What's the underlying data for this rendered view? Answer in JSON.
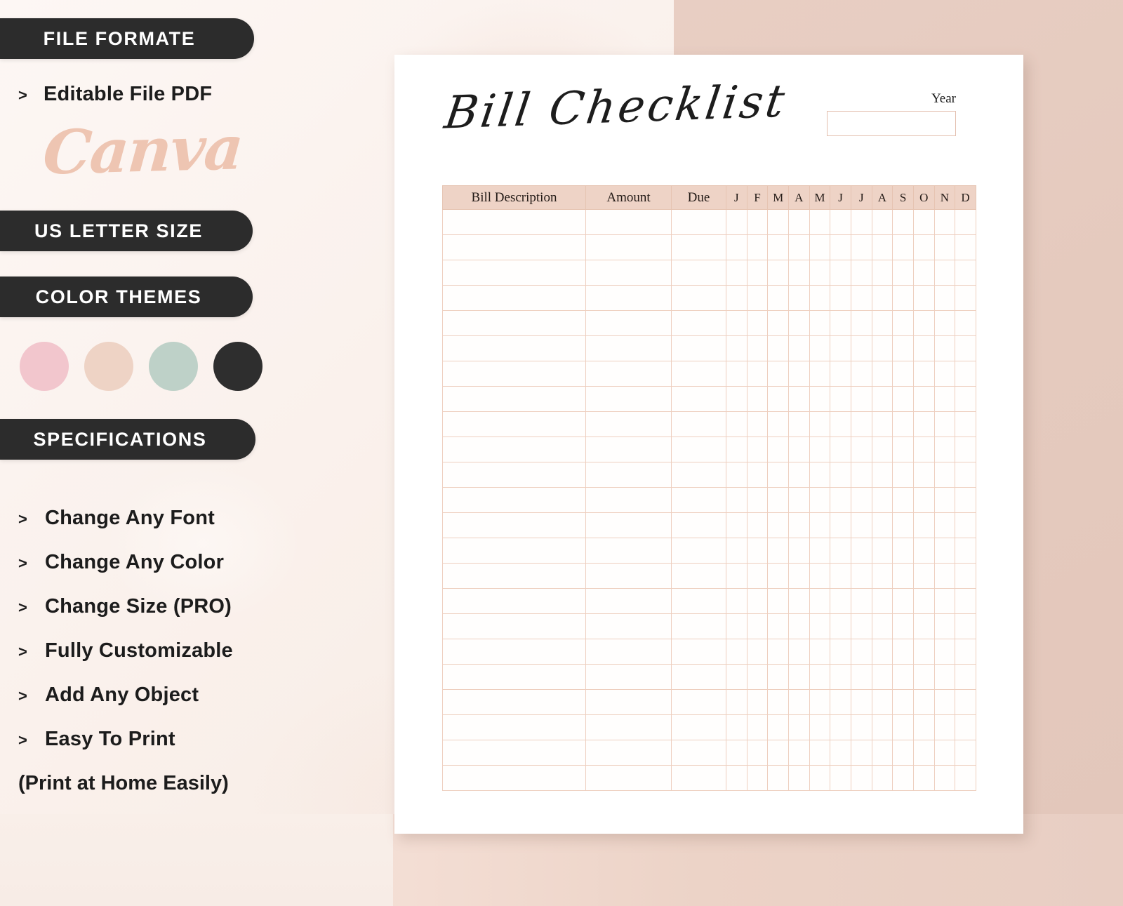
{
  "left_panel": {
    "badges": {
      "file_format": "FILE FORMATE",
      "letter_size": "US LETTER SIZE",
      "color_themes": "COLOR THEMES",
      "specifications": "SPECIFICATIONS"
    },
    "file_format_items": [
      {
        "bullet": ">",
        "label": "Editable File PDF"
      }
    ],
    "brand_wordmark": "Canva",
    "color_swatches": [
      {
        "name": "blush-pink",
        "hex": "#f2c6cd"
      },
      {
        "name": "peach-nude",
        "hex": "#eed3c5"
      },
      {
        "name": "sage-green",
        "hex": "#bed1c8"
      },
      {
        "name": "charcoal",
        "hex": "#2e2e2e"
      }
    ],
    "specification_items": [
      {
        "bullet": ">",
        "label": "Change Any Font"
      },
      {
        "bullet": ">",
        "label": "Change Any Color"
      },
      {
        "bullet": ">",
        "label": "Change Size (PRO)"
      },
      {
        "bullet": ">",
        "label": "Fully Customizable"
      },
      {
        "bullet": ">",
        "label": "Add Any Object"
      },
      {
        "bullet": ">",
        "label": "Easy To Print"
      }
    ],
    "specification_note": "(Print at Home Easily)"
  },
  "printable": {
    "title": "Bill Checklist",
    "year_label": "Year",
    "year_value": "",
    "table": {
      "headers": {
        "description": "Bill Description",
        "amount": "Amount",
        "due": "Due"
      },
      "months": [
        "J",
        "F",
        "M",
        "A",
        "M",
        "J",
        "J",
        "A",
        "S",
        "O",
        "N",
        "D"
      ],
      "row_count": 23,
      "rows_empty": true
    }
  },
  "theme": {
    "badge_bg": "#2c2c2c",
    "badge_text": "#ffffff",
    "body_text": "#1c1c1c",
    "canva_color": "#eec5b2",
    "table_header_bg": "#eed3c6",
    "table_border": "#eecfbf",
    "page_bg": "#ffffff",
    "rose_block": "#e5cabe",
    "left_wash": "#faf2ed"
  }
}
